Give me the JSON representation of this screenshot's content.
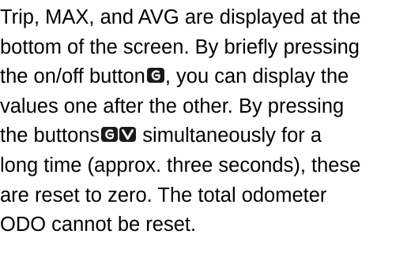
{
  "paragraph": {
    "line1": "Trip, MAX, and AVG are displayed at the",
    "line2": "bottom of the screen. By briefly pressing",
    "line3a": "the on/off button",
    "line3b": ", you can display the",
    "line4": "values one after the other. By pressing",
    "line5a": "the buttons",
    "line5b": " simultaneously for a",
    "line6": "long time (approx. three seconds), these",
    "line7": "are reset to zero. The total odometer",
    "line8": "ODO cannot be reset."
  },
  "icons": {
    "onoff_button": "c-button-icon",
    "combo_buttons": [
      "c-button-icon",
      "v-button-icon"
    ],
    "color": "#1a1a1a"
  }
}
